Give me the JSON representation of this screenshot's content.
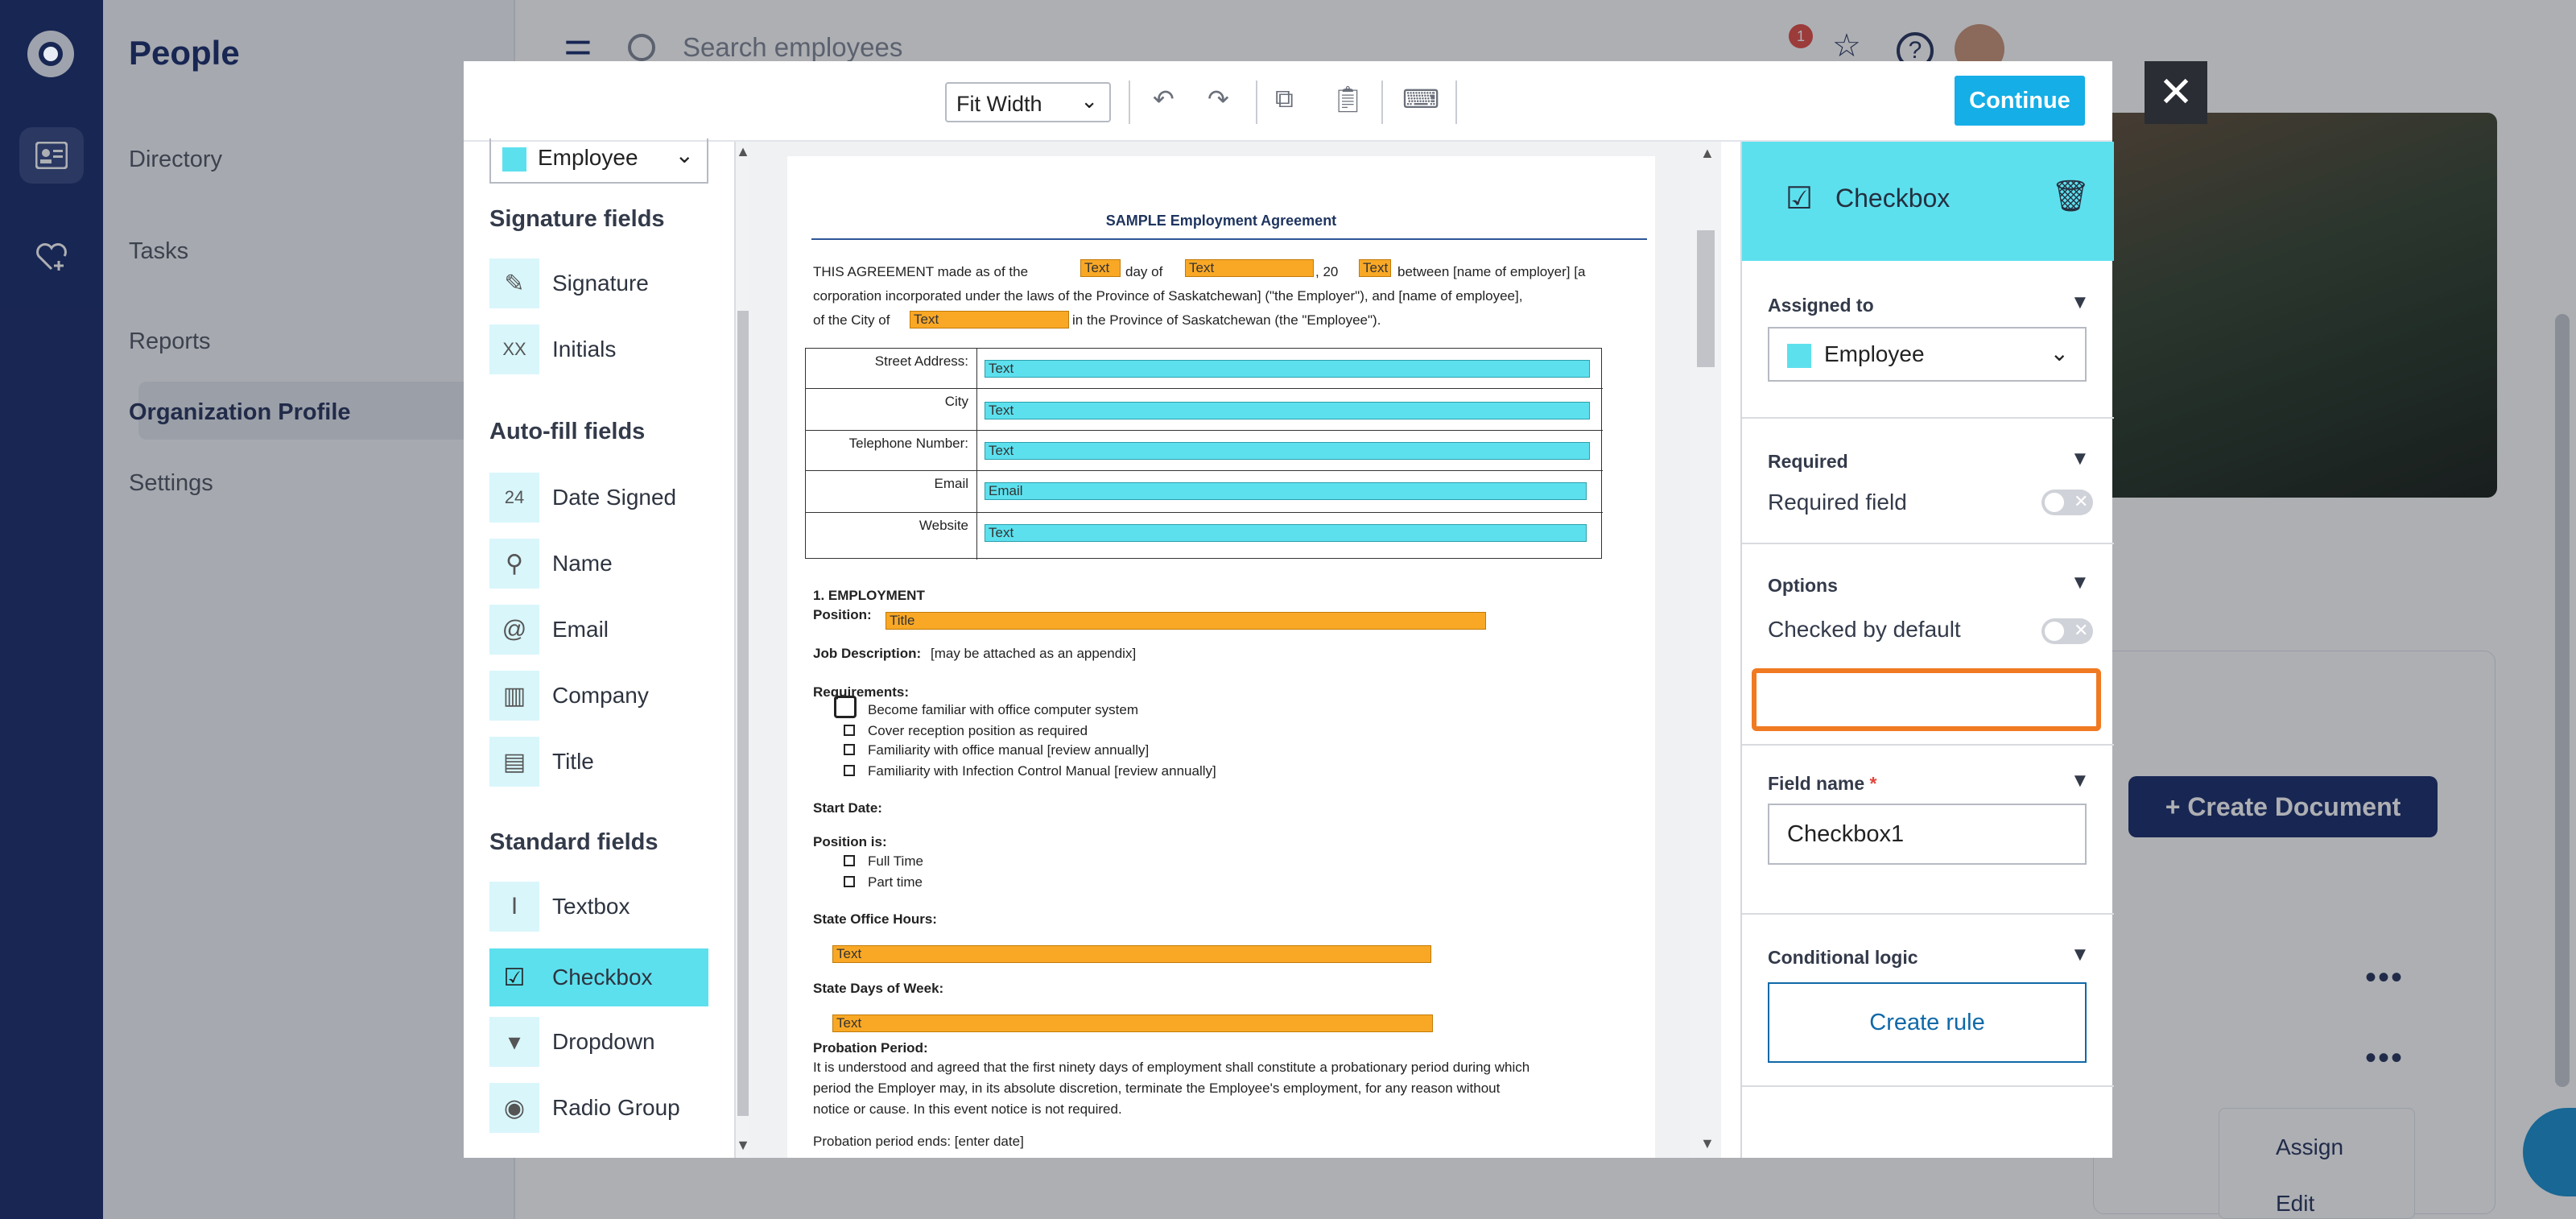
{
  "app": {
    "section_title": "People",
    "nav": [
      "Directory",
      "Tasks",
      "Reports",
      "Organization Profile",
      "Settings"
    ],
    "search_placeholder": "Search employees",
    "notification_count": "1",
    "create_document_label": "+ Create Document",
    "row_menu": [
      "Assign",
      "Edit"
    ]
  },
  "toolbar": {
    "zoom_value": "Fit Width",
    "continue_label": "Continue",
    "close_label": "✕"
  },
  "palette": {
    "assignee": "Employee",
    "groups": [
      {
        "title": "Signature fields",
        "items": [
          "Signature",
          "Initials"
        ]
      },
      {
        "title": "Auto-fill fields",
        "items": [
          "Date Signed",
          "Name",
          "Email",
          "Company",
          "Title"
        ]
      },
      {
        "title": "Standard fields",
        "items": [
          "Textbox",
          "Checkbox",
          "Dropdown",
          "Radio Group"
        ]
      }
    ],
    "active_item": "Checkbox"
  },
  "document": {
    "title": "SAMPLE Employment Agreement",
    "intro_1a": "THIS AGREEMENT made as of the",
    "intro_1b": "day of",
    "intro_1c": ", 20",
    "intro_1d": "between [name of employer] [a",
    "intro_2": "corporation incorporated under the laws of the Province of Saskatchewan] (\"the Employer\"), and [name of employee],",
    "intro_3a": "of the City of",
    "intro_3b": "in the Province of Saskatchewan (the \"Employee\").",
    "address_labels": [
      "Street Address:",
      "City",
      "Telephone Number:",
      "Email",
      "Website"
    ],
    "address_fields": [
      "Text",
      "Text",
      "Text",
      "Email",
      "Text"
    ],
    "field_text": "Text",
    "section1": "1.   EMPLOYMENT",
    "position_label": "Position:",
    "position_field": "Title",
    "job_desc_label": "Job Description:",
    "job_desc_text": "[may be attached as an appendix]",
    "requirements_label": "Requirements:",
    "requirements": [
      "Become familiar with office computer system",
      "Cover reception position as required",
      "Familiarity with office manual [review annually]",
      "Familiarity with Infection Control Manual [review annually]"
    ],
    "start_date_label": "Start Date:",
    "position_is_label": "Position is:",
    "position_options": [
      "Full Time",
      "Part time"
    ],
    "office_hours_label": "State Office Hours:",
    "days_label": "State Days of Week:",
    "probation_label": "Probation Period:",
    "probation_text_1": "It is understood and agreed that the first ninety days of employment shall constitute a probationary period during which",
    "probation_text_2": "period the Employer may, in its absolute discretion, terminate the Employee's employment, for any reason without",
    "probation_text_3": "notice or cause.  In this event notice is not required.",
    "probation_end": "Probation period ends: [enter date]"
  },
  "properties": {
    "field_type": "Checkbox",
    "assigned_to_label": "Assigned to",
    "assigned_to_value": "Employee",
    "required_label": "Required",
    "required_field_label": "Required field",
    "options_label": "Options",
    "checked_default_label": "Checked by default",
    "field_name_label": "Field name",
    "field_name_value": "Checkbox1",
    "conditional_label": "Conditional logic",
    "create_rule_label": "Create rule"
  },
  "colors": {
    "navy": "#0f2364",
    "accent": "#15aee6",
    "field_cyan": "#5de0ee",
    "field_orange": "#f9a826",
    "highlight": "#f07a22"
  }
}
